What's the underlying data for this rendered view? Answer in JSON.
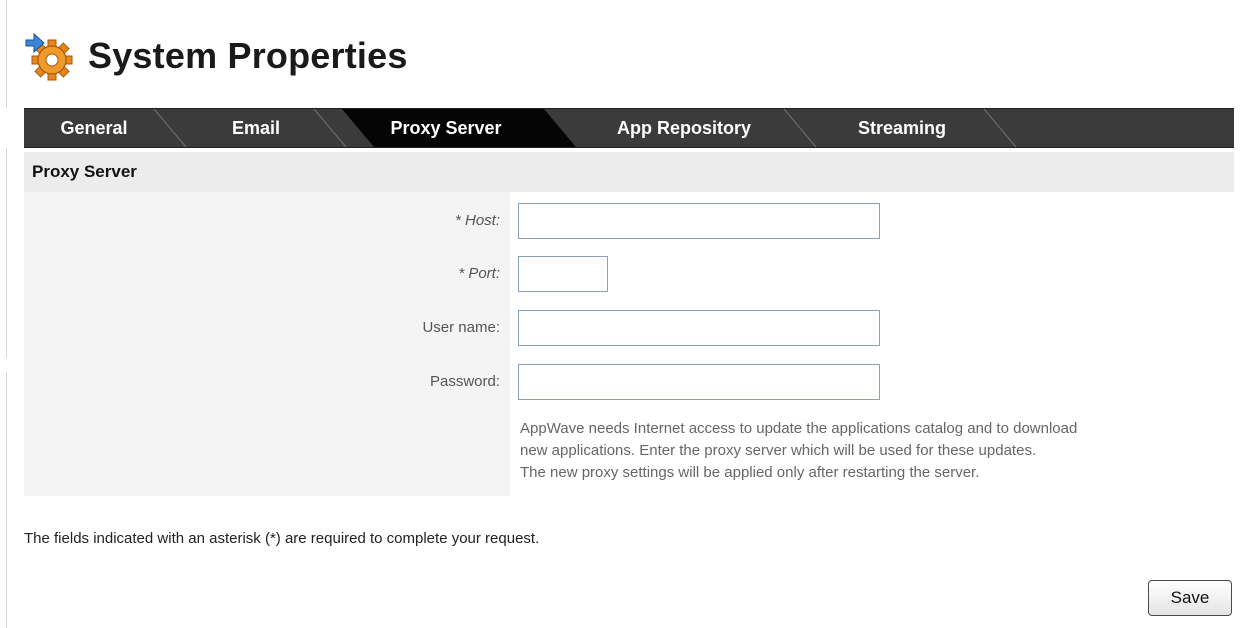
{
  "page": {
    "title": "System Properties"
  },
  "tabs": [
    {
      "label": "General",
      "active": false
    },
    {
      "label": "Email",
      "active": false
    },
    {
      "label": "Proxy Server",
      "active": true
    },
    {
      "label": "App Repository",
      "active": false
    },
    {
      "label": "Streaming",
      "active": false
    }
  ],
  "section": {
    "title": "Proxy Server"
  },
  "form": {
    "host": {
      "label": "* Host:",
      "value": ""
    },
    "port": {
      "label": "* Port:",
      "value": ""
    },
    "username": {
      "label": "User name:",
      "value": ""
    },
    "password": {
      "label": "Password:",
      "value": ""
    },
    "help_lines": [
      "AppWave needs Internet access to update the applications catalog and to download",
      "new applications. Enter the proxy server which will be used for these updates.",
      "The new proxy settings will be applied only after restarting the server."
    ]
  },
  "footer": {
    "required_note": "The fields indicated with an asterisk (*) are required to complete your request.",
    "save_label": "Save"
  },
  "colors": {
    "tabbar_bg": "#3b3b3b",
    "tab_active_bg": "#000000",
    "section_bg": "#ececec",
    "input_border": "#8aa1b8"
  },
  "icons": {
    "title_icon": "gear-with-arrow-icon"
  }
}
